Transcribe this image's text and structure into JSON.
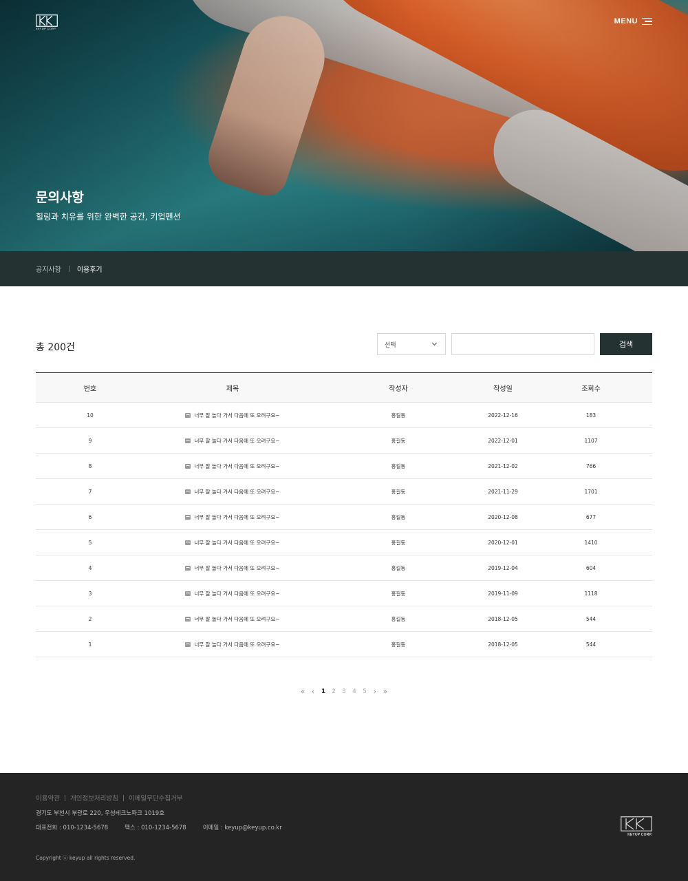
{
  "header": {
    "logo_text": "KEYUP CORP.",
    "menu_label": "MENU"
  },
  "hero": {
    "title": "문의사항",
    "subtitle": "힐링과 치유를 위한 완벽한 공간, 키업펜션"
  },
  "subnav": {
    "items": [
      {
        "label": "공지사항",
        "active": false
      },
      {
        "label": "이용후기",
        "active": true
      }
    ]
  },
  "board": {
    "total_label": "총 200건",
    "select_value": "선택",
    "search_value": "",
    "search_button": "검색",
    "columns": [
      "번호",
      "제목",
      "작성자",
      "작성일",
      "조회수"
    ],
    "rows": [
      {
        "no": "10",
        "title": "너무 잘 놀다 가서 다음에 또 오려구요~",
        "author": "홍길동",
        "date": "2022-12-16",
        "views": "183"
      },
      {
        "no": "9",
        "title": "너무 잘 놀다 가서 다음에 또 오려구요~",
        "author": "홍길동",
        "date": "2022-12-01",
        "views": "1107"
      },
      {
        "no": "8",
        "title": "너무 잘 놀다 가서 다음에 또 오려구요~",
        "author": "홍길동",
        "date": "2021-12-02",
        "views": "766"
      },
      {
        "no": "7",
        "title": "너무 잘 놀다 가서 다음에 또 오려구요~",
        "author": "홍길동",
        "date": "2021-11-29",
        "views": "1701"
      },
      {
        "no": "6",
        "title": "너무 잘 놀다 가서 다음에 또 오려구요~",
        "author": "홍길동",
        "date": "2020-12-08",
        "views": "677"
      },
      {
        "no": "5",
        "title": "너무 잘 놀다 가서 다음에 또 오려구요~",
        "author": "홍길동",
        "date": "2020-12-01",
        "views": "1410"
      },
      {
        "no": "4",
        "title": "너무 잘 놀다 가서 다음에 또 오려구요~",
        "author": "홍길동",
        "date": "2019-12-04",
        "views": "604"
      },
      {
        "no": "3",
        "title": "너무 잘 놀다 가서 다음에 또 오려구요~",
        "author": "홍길동",
        "date": "2019-11-09",
        "views": "1118"
      },
      {
        "no": "2",
        "title": "너무 잘 놀다 가서 다음에 또 오려구요~",
        "author": "홍길동",
        "date": "2018-12-05",
        "views": "544"
      },
      {
        "no": "1",
        "title": "너무 잘 놀다 가서 다음에 또 오려구요~",
        "author": "홍길동",
        "date": "2018-12-05",
        "views": "544"
      }
    ]
  },
  "pagination": {
    "first": "«",
    "prev": "‹",
    "pages": [
      "1",
      "2",
      "3",
      "4",
      "5"
    ],
    "current": "1",
    "next": "›",
    "last": "»"
  },
  "footer": {
    "links": [
      "이용약관",
      "개인정보처리방침",
      "이메일무단수집거부"
    ],
    "address": "경기도 부천시 부광로 220, 우성테크노파크 1019호",
    "phone": "대표전화 : 010-1234-5678",
    "fax": "팩스 : 010-1234-5678",
    "email": "이메일 : keyup@keyup.co.kr",
    "copyright": "Copyright ⓒ keyup all rights reserved.",
    "logo_text": "KEYUP CORP."
  },
  "colors": {
    "primary": "#243331",
    "footer_bg": "#242424"
  }
}
